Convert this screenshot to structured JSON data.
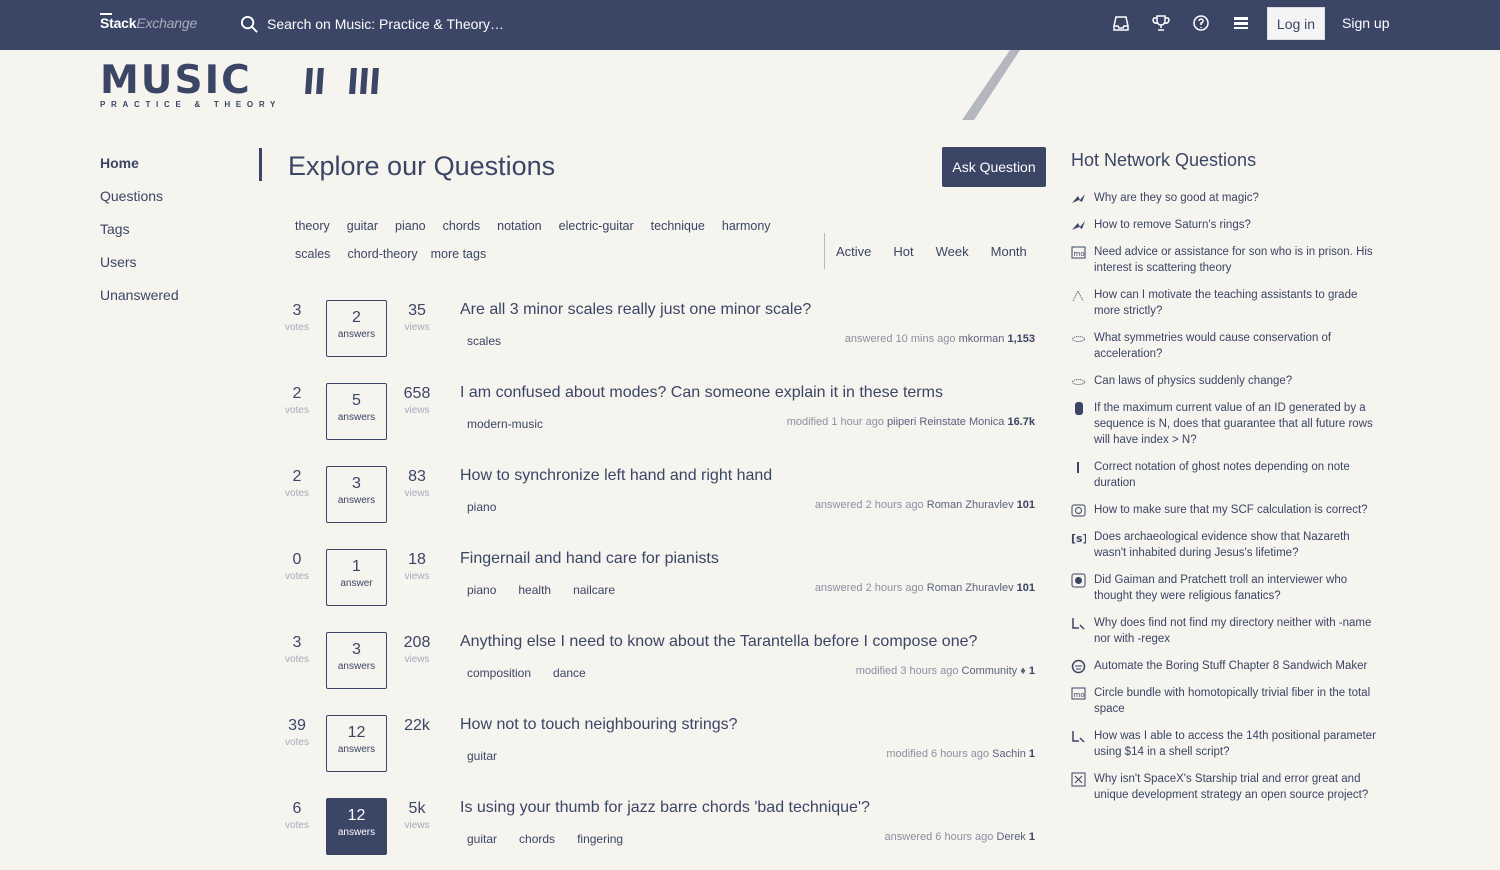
{
  "topbar": {
    "brand_a": "Stack",
    "brand_b": "Exchange",
    "search_placeholder": "Search on Music: Practice & Theory…",
    "login": "Log in",
    "signup": "Sign up",
    "icons": [
      "inbox-icon",
      "trophy-icon",
      "help-icon",
      "site-switcher-icon"
    ]
  },
  "site": {
    "name": "MUSIC",
    "subtitle": "PRACTICE & THEORY"
  },
  "nav": {
    "items": [
      "Home",
      "Questions",
      "Tags",
      "Users",
      "Unanswered"
    ],
    "active": "Home"
  },
  "main": {
    "title": "Explore our Questions",
    "ask_button": "Ask Question",
    "tags_row1": [
      "theory",
      "guitar",
      "piano",
      "chords",
      "notation",
      "electric-guitar",
      "technique",
      "harmony"
    ],
    "tags_row2": [
      "scales",
      "chord-theory",
      "more tags"
    ],
    "tabs": [
      "Active",
      "Hot",
      "Week",
      "Month"
    ]
  },
  "questions": [
    {
      "votes": "3",
      "votes_label": "votes",
      "answers": "2",
      "answers_label": "answers",
      "views": "35",
      "views_label": "views",
      "accepted": false,
      "title": "Are all 3 minor scales really just one minor scale?",
      "tags": [
        "scales"
      ],
      "action": "answered",
      "time": "10 mins ago",
      "user": "mkorman",
      "rep": "1,153"
    },
    {
      "votes": "2",
      "votes_label": "votes",
      "answers": "5",
      "answers_label": "answers",
      "views": "658",
      "views_label": "views",
      "accepted": false,
      "title": "I am confused about modes? Can someone explain it in these terms",
      "tags": [
        "modern-music"
      ],
      "action": "modified",
      "time": "1 hour ago",
      "user": "piiperi Reinstate Monica",
      "rep": "16.7k"
    },
    {
      "votes": "2",
      "votes_label": "votes",
      "answers": "3",
      "answers_label": "answers",
      "views": "83",
      "views_label": "views",
      "accepted": false,
      "title": "How to synchronize left hand and right hand",
      "tags": [
        "piano"
      ],
      "action": "answered",
      "time": "2 hours ago",
      "user": "Roman Zhuravlev",
      "rep": "101"
    },
    {
      "votes": "0",
      "votes_label": "votes",
      "answers": "1",
      "answers_label": "answer",
      "views": "18",
      "views_label": "views",
      "accepted": false,
      "title": "Fingernail and hand care for pianists",
      "tags": [
        "piano",
        "health",
        "nailcare"
      ],
      "action": "answered",
      "time": "2 hours ago",
      "user": "Roman Zhuravlev",
      "rep": "101"
    },
    {
      "votes": "3",
      "votes_label": "votes",
      "answers": "3",
      "answers_label": "answers",
      "views": "208",
      "views_label": "views",
      "accepted": false,
      "title": "Anything else I need to know about the Tarantella before I compose one?",
      "tags": [
        "composition",
        "dance"
      ],
      "action": "modified",
      "time": "3 hours ago",
      "user": "Community ♦",
      "rep": "1"
    },
    {
      "votes": "39",
      "votes_label": "votes",
      "answers": "12",
      "answers_label": "answers",
      "views": "22k",
      "views_label": "",
      "accepted": false,
      "title": "How not to touch neighbouring strings?",
      "tags": [
        "guitar"
      ],
      "action": "modified",
      "time": "6 hours ago",
      "user": "Sachin",
      "rep": "1"
    },
    {
      "votes": "6",
      "votes_label": "votes",
      "answers": "12",
      "answers_label": "answers",
      "views": "5k",
      "views_label": "views",
      "accepted": true,
      "title": "Is using your thumb for jazz barre chords 'bad technique'?",
      "tags": [
        "guitar",
        "chords",
        "fingering"
      ],
      "action": "answered",
      "time": "6 hours ago",
      "user": "Derek",
      "rep": "1"
    }
  ],
  "hot_network": {
    "title": "Hot Network Questions",
    "items": [
      {
        "icon": "scifi-icon",
        "text": "Why are they so good at magic?"
      },
      {
        "icon": "scifi-icon",
        "text": "How to remove Saturn's rings?"
      },
      {
        "icon": "mathoverflow-icon",
        "text": "Need advice or assistance for son who is in prison. His interest is scattering theory"
      },
      {
        "icon": "academia-icon",
        "text": "How can I motivate the teaching assistants to grade more strictly?"
      },
      {
        "icon": "physics-icon",
        "text": "What symmetries would cause conservation of acceleration?"
      },
      {
        "icon": "physics-icon",
        "text": "Can laws of physics suddenly change?"
      },
      {
        "icon": "dba-icon",
        "text": "If the maximum current value of an ID generated by a sequence is N, does that guarantee that all future rows will have index > N?"
      },
      {
        "icon": "music-icon",
        "text": "Correct notation of ghost notes depending on note duration"
      },
      {
        "icon": "chemistry-icon",
        "text": "How to make sure that my SCF calculation is correct?"
      },
      {
        "icon": "history-icon",
        "text": "Does archaeological evidence show that Nazareth wasn't inhabited during Jesus's lifetime?"
      },
      {
        "icon": "skeptics-icon",
        "text": "Did Gaiman and Pratchett troll an interviewer who thought they were religious fanatics?"
      },
      {
        "icon": "unix-icon",
        "text": "Why does find not find my directory neither with -name nor with -regex"
      },
      {
        "icon": "cooking-icon",
        "text": "Automate the Boring Stuff Chapter 8 Sandwich Maker"
      },
      {
        "icon": "mathoverflow-icon",
        "text": "Circle bundle with homotopically trivial fiber in the total space"
      },
      {
        "icon": "unix-icon",
        "text": "How was I able to access the 14th positional parameter using $14 in a shell script?"
      },
      {
        "icon": "opensource-icon",
        "text": "Why isn't SpaceX's Starship trial and error great and unique development strategy an open source project?"
      }
    ]
  }
}
